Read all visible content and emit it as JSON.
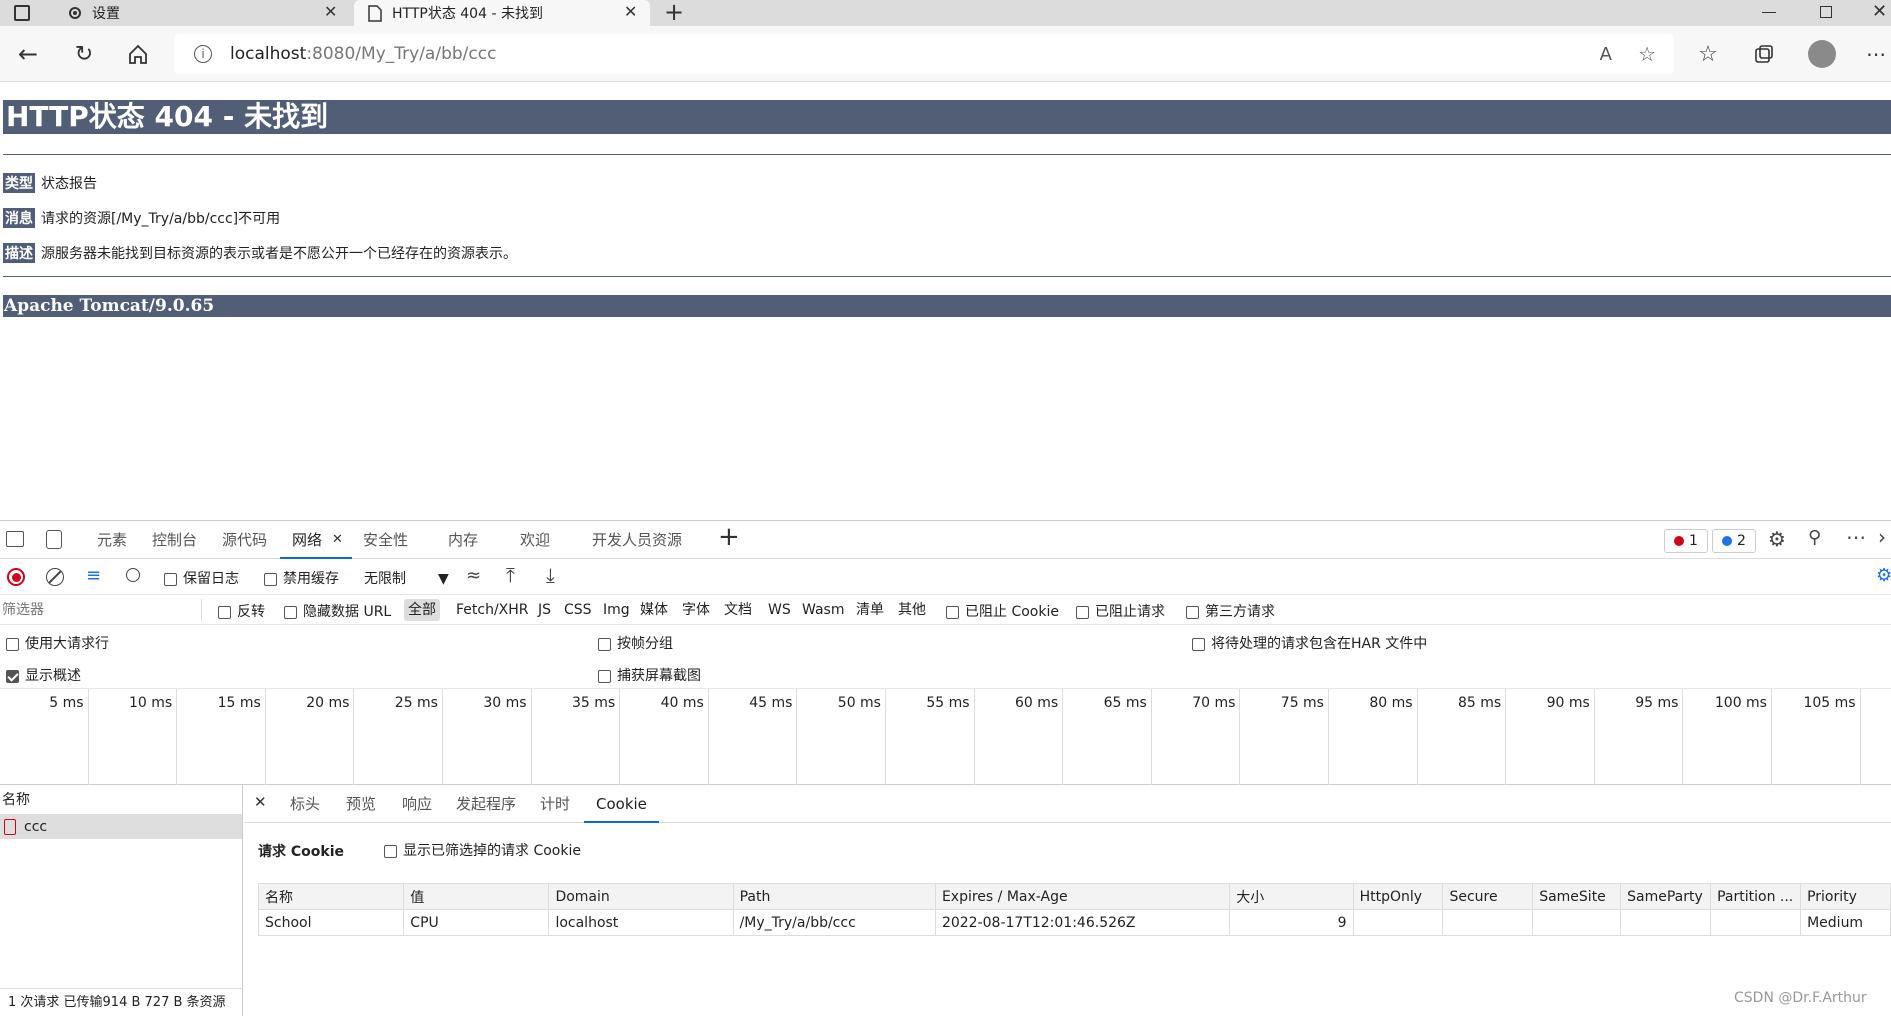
{
  "browser": {
    "tabs": [
      {
        "title": "设置",
        "icon": "gear-icon"
      },
      {
        "title": "HTTP状态 404 - 未找到",
        "icon": "page-icon"
      }
    ],
    "address": {
      "host": "localhost",
      "path": ":8080/My_Try/a/bb/ccc"
    }
  },
  "page": {
    "title": "HTTP状态 404 - 未找到",
    "rows": [
      {
        "label": "类型",
        "text": "状态报告"
      },
      {
        "label": "消息",
        "text": "请求的资源[/My_Try/a/bb/ccc]不可用"
      },
      {
        "label": "描述",
        "text": "源服务器未能找到目标资源的表示或者是不愿公开一个已经存在的资源表示。"
      }
    ],
    "footer": "Apache Tomcat/9.0.65"
  },
  "devtools": {
    "tabs": [
      "元素",
      "控制台",
      "源代码",
      "网络",
      "安全性",
      "内存",
      "欢迎",
      "开发人员资源"
    ],
    "active_tab": "网络",
    "badges": {
      "errors": "1",
      "messages": "2"
    },
    "toolbar": {
      "preserve_log": "保留日志",
      "disable_cache": "禁用缓存",
      "throttle": "无限制"
    },
    "filter": {
      "placeholder": "筛选器",
      "invert": "反转",
      "hide_data_urls": "隐藏数据 URL",
      "types": [
        "全部",
        "Fetch/XHR",
        "JS",
        "CSS",
        "Img",
        "媒体",
        "字体",
        "文档",
        "WS",
        "Wasm",
        "清单",
        "其他"
      ],
      "blocked_cookies": "已阻止 Cookie",
      "blocked_requests": "已阻止请求",
      "third_party": "第三方请求"
    },
    "options": {
      "large_rows": "使用大请求行",
      "group_by_frame": "按帧分组",
      "include_har": "将待处理的请求包含在HAR 文件中",
      "show_overview": "显示概述",
      "capture_screenshots": "捕获屏幕截图"
    },
    "timeline": [
      "5 ms",
      "10 ms",
      "15 ms",
      "20 ms",
      "25 ms",
      "30 ms",
      "35 ms",
      "40 ms",
      "45 ms",
      "50 ms",
      "55 ms",
      "60 ms",
      "65 ms",
      "70 ms",
      "75 ms",
      "80 ms",
      "85 ms",
      "90 ms",
      "95 ms",
      "100 ms",
      "105 ms"
    ],
    "request_list": {
      "header": "名称",
      "items": [
        "ccc"
      ]
    },
    "detail_tabs": [
      "标头",
      "预览",
      "响应",
      "发起程序",
      "计时",
      "Cookie"
    ],
    "active_detail_tab": "Cookie",
    "cookies": {
      "section_title": "请求 Cookie",
      "show_filtered": "显示已筛选掉的请求 Cookie",
      "columns": [
        "名称",
        "值",
        "Domain",
        "Path",
        "Expires / Max-Age",
        "大小",
        "HttpOnly",
        "Secure",
        "SameSite",
        "SameParty",
        "Partition ...",
        "Priority"
      ],
      "rows": [
        [
          "School",
          "CPU",
          "localhost",
          "/My_Try/a/bb/ccc",
          "2022-08-17T12:01:46.526Z",
          "9",
          "",
          "",
          "",
          "",
          "",
          "Medium"
        ]
      ]
    },
    "status_bar": "1 次请求  已传输914 B  727 B 条资源"
  },
  "watermark": "CSDN @Dr.F.Arthur"
}
